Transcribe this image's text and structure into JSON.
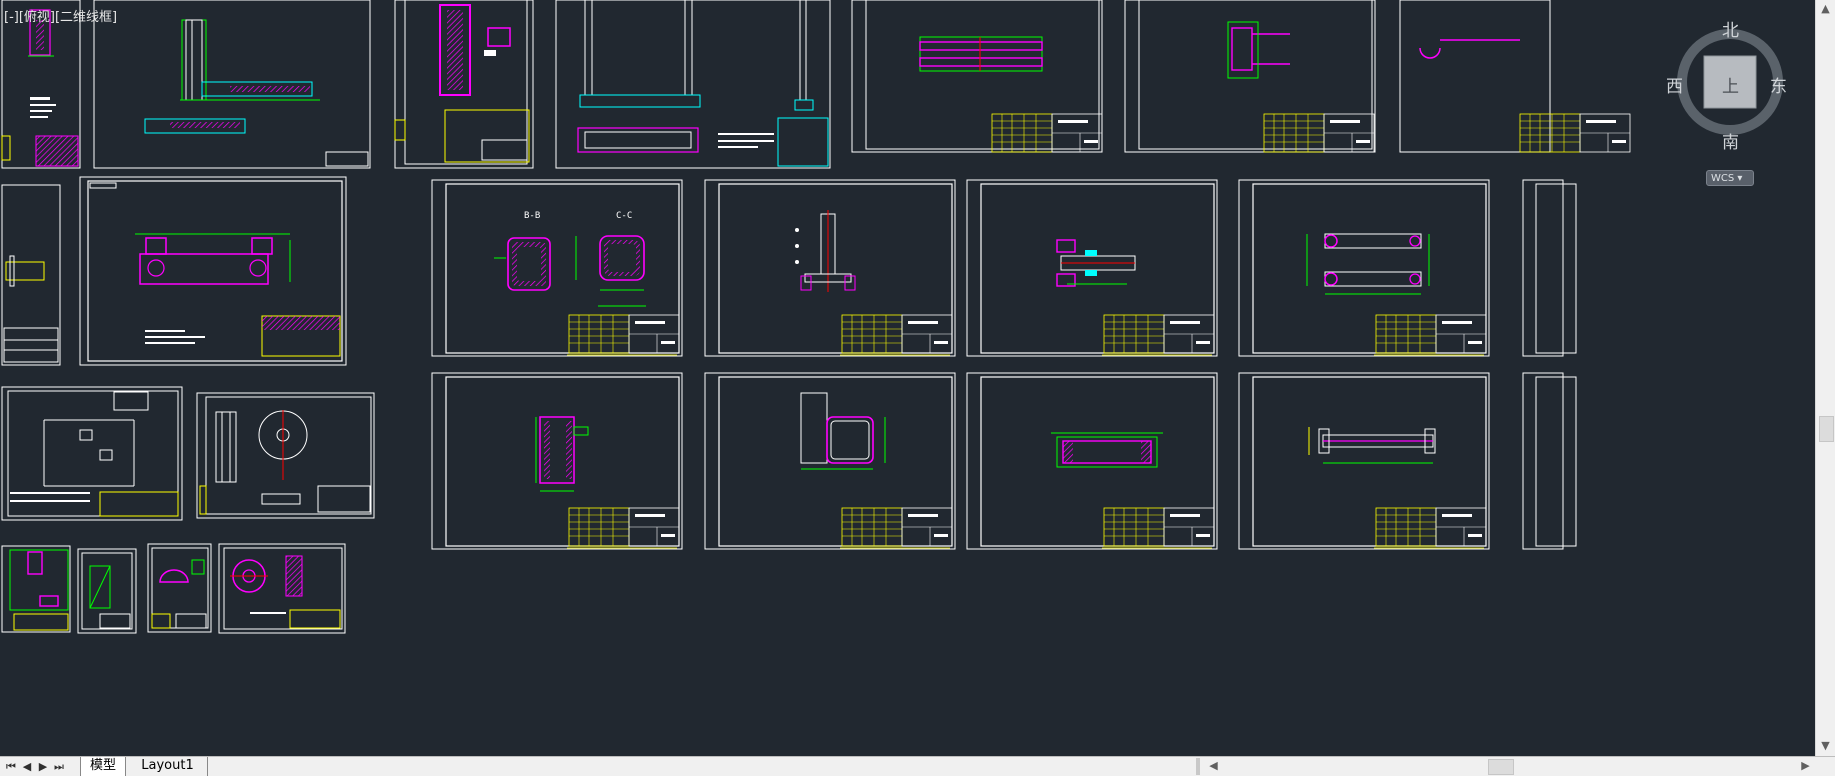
{
  "viewport": {
    "view_label": "[-][俯视][二维线框]",
    "background_color": "#212830"
  },
  "viewcube": {
    "north": "北",
    "south": "南",
    "east": "东",
    "west": "西",
    "face": "上",
    "wcs_label": "WCS"
  },
  "drawing_labels": {
    "section_b": "B-B",
    "section_c": "C-C"
  },
  "layout_tabs": {
    "model": "模型",
    "layout1": "Layout1"
  },
  "nav_icons": [
    "first-icon",
    "prev-icon",
    "next-icon",
    "last-icon"
  ],
  "colors": {
    "frame": "#ffffff",
    "title_block": "#ffff00",
    "part": "#ff00ff",
    "dimension": "#00ff00",
    "cyan": "#00ffff",
    "red": "#ff0000"
  }
}
